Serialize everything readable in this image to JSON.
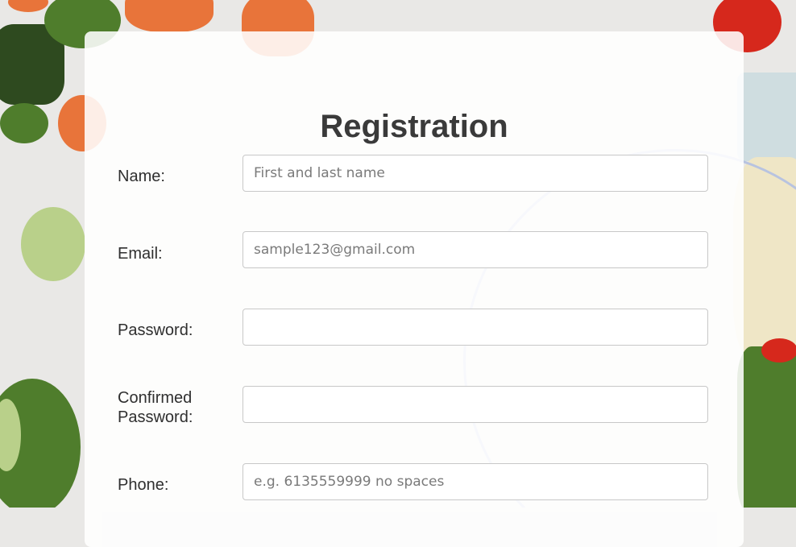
{
  "form": {
    "title": "Registration",
    "fields": [
      {
        "label": "Name:",
        "placeholder": "First and last name",
        "value": ""
      },
      {
        "label": "Email:",
        "placeholder": "sample123@gmail.com",
        "value": ""
      },
      {
        "label": "Password:",
        "placeholder": "",
        "value": ""
      },
      {
        "label": "Confirmed Password:",
        "placeholder": "",
        "value": ""
      },
      {
        "label": "Phone:",
        "placeholder": "e.g. 6135559999 no spaces",
        "value": ""
      }
    ]
  }
}
